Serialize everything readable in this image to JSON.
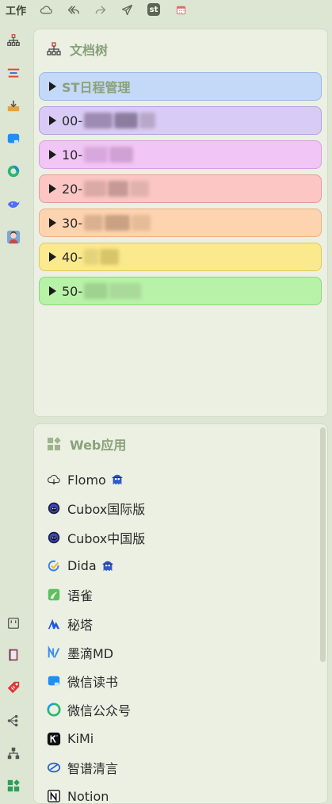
{
  "toolbar": {
    "title": "工作",
    "st_label": "st",
    "icons": [
      "cloud-icon",
      "reply-all-icon",
      "forward-icon",
      "send-icon",
      "st-icon",
      "calendar-icon"
    ]
  },
  "dock": {
    "top_icons": [
      "doc-tree-icon",
      "outline-icon",
      "inbox-download-icon",
      "wechat-read-icon",
      "wechat-official-icon",
      "deepseek-icon",
      "avatar-icon"
    ],
    "bottom_icons": [
      "panel-icon",
      "notebook-icon",
      "tag-icon",
      "graph-icon",
      "tree-icon",
      "apps-icon"
    ]
  },
  "doc_tree": {
    "title": "文档树",
    "notebooks": [
      {
        "label": "ST日程管理",
        "bg": "#c4d9f8",
        "border": "#9ab8e4"
      },
      {
        "label": "00-",
        "bg": "#d8cbf6",
        "border": "#b4a1e3"
      },
      {
        "label": "10-",
        "bg": "#f1c5f5",
        "border": "#d89ee0"
      },
      {
        "label": "20-",
        "bg": "#fbc6c4",
        "border": "#e09e9a"
      },
      {
        "label": "30-",
        "bg": "#fed3b0",
        "border": "#e8b184"
      },
      {
        "label": "40-",
        "bg": "#fbe98d",
        "border": "#e1c95f"
      },
      {
        "label": "50-",
        "bg": "#b8f1a8",
        "border": "#8fd47d"
      }
    ]
  },
  "web_apps": {
    "title": "Web应用",
    "items": [
      {
        "name": "Flomo",
        "icon": "flomo-icon"
      },
      {
        "name": "Cubox国际版",
        "icon": "cubox-icon"
      },
      {
        "name": "Cubox中国版",
        "icon": "cubox-icon"
      },
      {
        "name": "Dida",
        "icon": "dida-icon"
      },
      {
        "name": "语雀",
        "icon": "yuque-icon"
      },
      {
        "name": "秘塔",
        "icon": "metaso-icon"
      },
      {
        "name": "墨滴MD",
        "icon": "mdnice-icon"
      },
      {
        "name": "微信读书",
        "icon": "wechat-read-icon"
      },
      {
        "name": "微信公众号",
        "icon": "wechat-official-icon"
      },
      {
        "name": "KiMi",
        "icon": "kimi-icon"
      },
      {
        "name": "智谱清言",
        "icon": "zhipu-icon"
      },
      {
        "name": "Notion",
        "icon": "notion-icon"
      }
    ]
  },
  "colors": {
    "accent_green": "#8aa17a",
    "panel_bg": "#ebf0e3",
    "app_bg": "#dde6d3"
  }
}
